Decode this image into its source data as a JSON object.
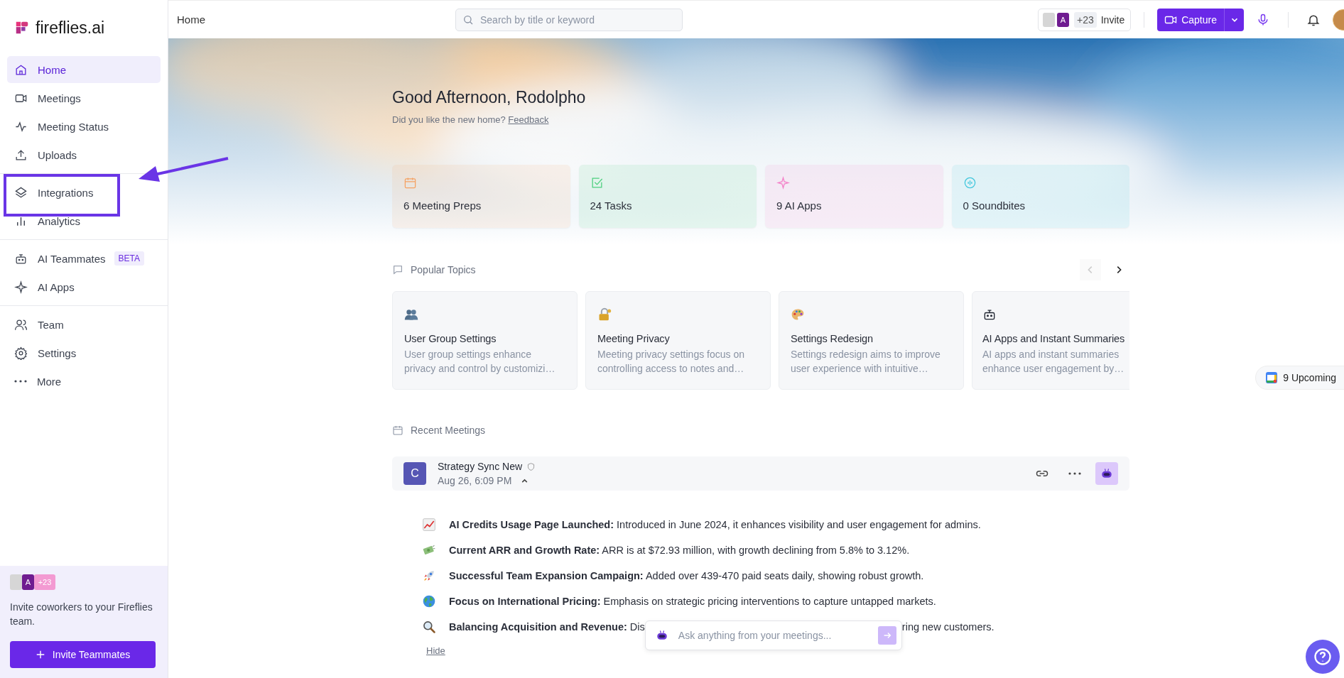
{
  "sidebar": {
    "logo": "fireflies.ai",
    "groups": [
      [
        {
          "label": "Home",
          "selected": true,
          "highlighted": false
        },
        {
          "label": "Meetings",
          "selected": false,
          "highlighted": false
        },
        {
          "label": "Meeting Status",
          "selected": false,
          "highlighted": false
        },
        {
          "label": "Uploads",
          "selected": false,
          "highlighted": false
        }
      ],
      [
        {
          "label": "Integrations",
          "selected": false,
          "highlighted": true
        },
        {
          "label": "Analytics",
          "selected": false,
          "highlighted": false
        }
      ],
      [
        {
          "label": "AI Teammates",
          "selected": false,
          "highlighted": false,
          "badge": "BETA"
        },
        {
          "label": "AI Apps",
          "selected": false,
          "highlighted": false
        }
      ],
      [
        {
          "label": "Team",
          "selected": false,
          "highlighted": false
        },
        {
          "label": "Settings",
          "selected": false,
          "highlighted": false
        },
        {
          "label": "More",
          "selected": false,
          "highlighted": false
        }
      ]
    ],
    "invite_panel": {
      "avatar_letter": "A",
      "count": "+23",
      "text": "Invite coworkers to your Fireflies team.",
      "button": "Invite Teammates"
    }
  },
  "top_bar": {
    "breadcrumb": "Home",
    "search": {
      "placeholder": "Search by title or keyword"
    },
    "invite": {
      "avatar_letter": "A",
      "count": "+23",
      "label": "Invite"
    },
    "capture_button": "Capture"
  },
  "greeting": {
    "title": "Good Afternoon, Rodolpho",
    "prompt": "Did you like the new home?",
    "link": "Feedback"
  },
  "stats": [
    {
      "label": "6 Meeting Preps",
      "color": "#f5a263"
    },
    {
      "label": "24 Tasks",
      "color": "#4ccf7d"
    },
    {
      "label": "9 AI Apps",
      "color": "#f47fc8"
    },
    {
      "label": "0 Soundbites",
      "color": "#3fc6dc"
    }
  ],
  "popular_topics": {
    "title": "Popular Topics",
    "prev_disabled": true,
    "items": [
      {
        "title": "User Group Settings",
        "description": "User group settings enhance privacy and control by customizi…"
      },
      {
        "title": "Meeting Privacy",
        "description": "Meeting privacy settings focus on controlling access to notes and…"
      },
      {
        "title": "Settings Redesign",
        "description": "Settings redesign aims to improve user experience with intuitive…"
      },
      {
        "title": "AI Apps and Instant Summaries",
        "description": "AI apps and instant summaries enhance user engagement by…"
      }
    ]
  },
  "recent_meetings": {
    "title": "Recent Meetings",
    "meeting": {
      "avatar": "C",
      "title": "Strategy Sync New",
      "date": "Aug 26, 6:09 PM",
      "expanded": true
    },
    "highlights": [
      {
        "text": "**AI Credits Usage Page Launched:** Introduced in June 2024, it enhances visibility and user engagement for admins."
      },
      {
        "text": "**Current ARR and Growth Rate:** ARR is at $72.93 million, with growth declining from 5.8% to 3.12%."
      },
      {
        "text": "**Successful Team Expansion Campaign:** Added over 439-470 paid seats daily, showing robust growth."
      },
      {
        "text": "**Focus on International Pricing:** Emphasis on strategic pricing interventions to capture untapped markets."
      },
      {
        "text": "**Balancing Acquisition and Revenue:** Dis",
        "tail": "ring new customers."
      }
    ],
    "hide_link": "Hide"
  },
  "ask_bar": {
    "placeholder": "Ask anything from your meetings..."
  },
  "upcoming": {
    "label": "9 Upcoming"
  }
}
